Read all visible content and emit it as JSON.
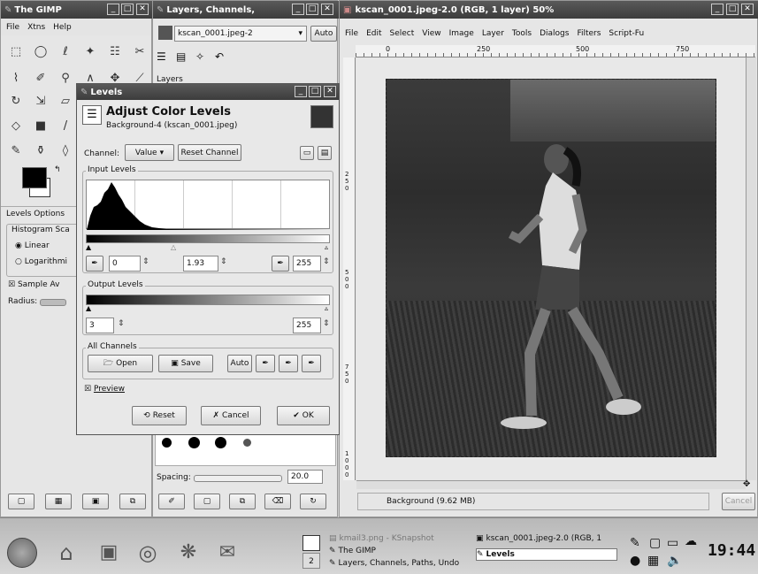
{
  "toolbox": {
    "title": "The GIMP",
    "menu": [
      "File",
      "Xtns",
      "Help"
    ],
    "options_title": "Levels Options",
    "histogram_scale": "Histogram Sca",
    "linear": "Linear",
    "logarithmic": "Logarithmi",
    "sample_average": "Sample Av",
    "radius": "Radius:"
  },
  "layers_dialog": {
    "title": "Layers, Channels,",
    "image_select": "kscan_0001.jpeg-2",
    "auto_button": "Auto",
    "layers_label": "Layers",
    "spacing_label": "Spacing:",
    "spacing_value": "20.0"
  },
  "image_window": {
    "title": "kscan_0001.jpeg-2.0 (RGB, 1 layer) 50%",
    "menu": [
      "File",
      "Edit",
      "Select",
      "View",
      "Image",
      "Layer",
      "Tools",
      "Dialogs",
      "Filters",
      "Script-Fu"
    ],
    "ruler_h": [
      "0",
      "250",
      "500",
      "750"
    ],
    "ruler_v": [
      "2\n5\n0",
      "5\n0\n0",
      "7\n5\n0",
      "1\n0\n0\n0"
    ],
    "status": "Background (9.62 MB)",
    "cancel": "Cancel"
  },
  "levels": {
    "title": "Levels",
    "heading": "Adjust Color Levels",
    "subheading": "Background-4 (kscan_0001.jpeg)",
    "channel_label": "Channel:",
    "channel_value": "Value",
    "reset_channel": "Reset Channel",
    "input_levels": "Input Levels",
    "input_low": "0",
    "input_gamma": "1.93",
    "input_high": "255",
    "output_levels": "Output Levels",
    "output_low": "3",
    "output_high": "255",
    "all_channels": "All Channels",
    "open": "Open",
    "save": "Save",
    "auto": "Auto",
    "preview": "Preview",
    "reset": "Reset",
    "cancel": "Cancel",
    "ok": "OK"
  },
  "taskbar": {
    "desk_number": "2",
    "tasks": [
      "kmail3.png - KSnapshot",
      "The GIMP",
      "Layers, Channels, Paths, Undo",
      "kscan_0001.jpeg-2.0 (RGB, 1",
      "Levels"
    ],
    "clock": "19:44"
  },
  "colors": {
    "titlebar": "#3c3c3c",
    "panel": "#e8e8e8",
    "taskbar": "#c8c8c8"
  }
}
